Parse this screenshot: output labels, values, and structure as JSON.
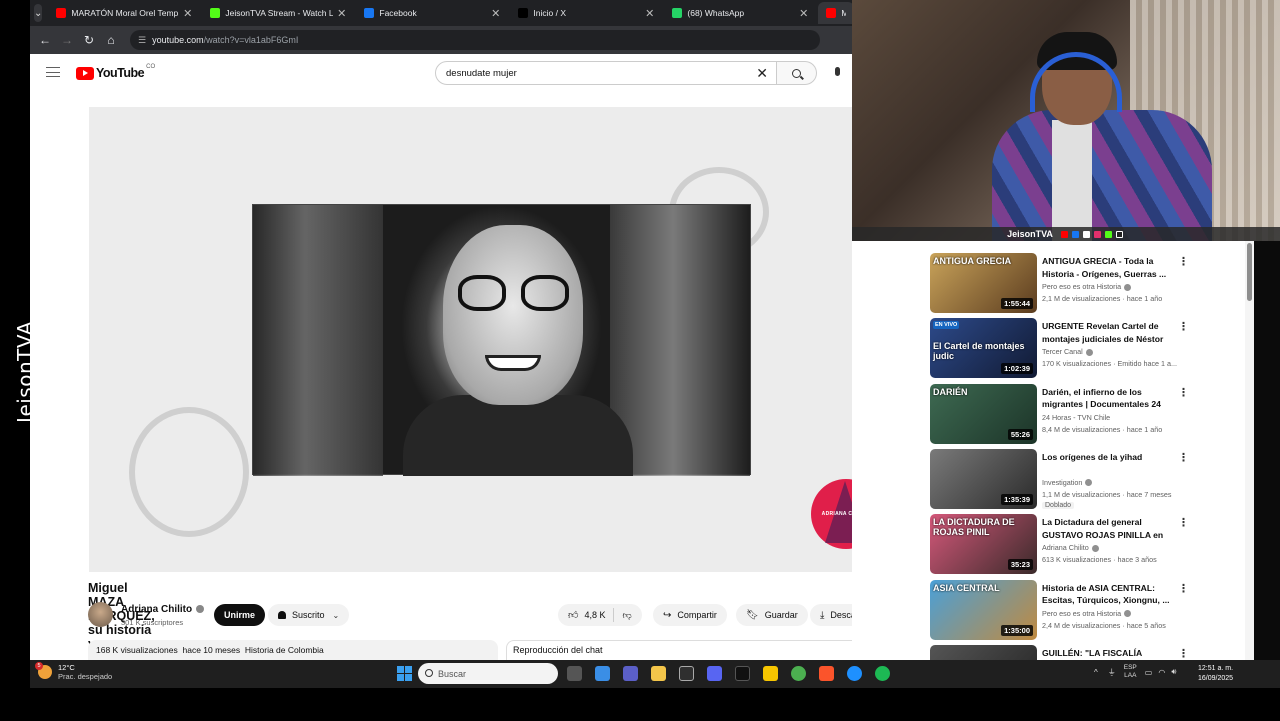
{
  "stream_brand": "JeisonTVA",
  "browser": {
    "tabs": [
      {
        "title": "MARATÓN Moral Orel Temp. 2",
        "favicon_color": "#ff0000",
        "active": false
      },
      {
        "title": "JeisonTVA Stream - Watch Live",
        "favicon_color": "#53fc18",
        "active": false
      },
      {
        "title": "Facebook",
        "favicon_color": "#1877f2",
        "active": false
      },
      {
        "title": "Inicio / X",
        "favicon_color": "#000000",
        "active": false
      },
      {
        "title": "(68) WhatsApp",
        "favicon_color": "#25d366",
        "active": false
      },
      {
        "title": "Migu",
        "favicon_color": "#ff0000",
        "active": true
      }
    ],
    "url_domain": "youtube.com",
    "url_path": "/watch?v=vla1abF6GmI"
  },
  "youtube": {
    "logo_text": "YouTube",
    "country_code": "CO",
    "search_value": "desnudate mujer",
    "video": {
      "title": "Miguel MAZA MÁRQUEZ, su historia y trayectoria como director del DAS/ Documental",
      "watermark": "ADRIANA CHILITO",
      "channel": "Adriana Chilito",
      "subscribers": "301 K suscriptores",
      "join_label": "Unirme",
      "subscribed_label": "Suscrito",
      "likes": "4,8 K",
      "share_label": "Compartir",
      "save_label": "Guardar",
      "download_label": "Descargar",
      "views": "168 K visualizaciones",
      "age": "hace 10 meses",
      "hashtag": "Historia de Colombia",
      "chat_replay": "Reproducción del chat"
    }
  },
  "webcam_bar": {
    "name": "JeisonTVA"
  },
  "recommendations": [
    {
      "title": "ANTIGUA GRECIA - Toda la Historia - Orígenes, Guerras ...",
      "channel": "Pero eso es otra Historia",
      "verified": true,
      "meta": "2,1 M de visualizaciones · hace 1 año",
      "duration": "1:55:44",
      "overlay": "ANTIGUA GRECIA",
      "thumb": [
        "#c9a35a",
        "#5b3c1f"
      ],
      "badge": ""
    },
    {
      "title": "URGENTE Revelan Cartel de montajes judiciales de Néstor ...",
      "channel": "Tercer Canal",
      "verified": true,
      "meta": "170 K visualizaciones · Emitido hace 1 a...",
      "duration": "1:02:39",
      "overlay": "El Cartel de montajes judic",
      "thumb": [
        "#2d4a8a",
        "#111a33"
      ],
      "badge": "",
      "live": "EN VIVO"
    },
    {
      "title": "Darién, el infierno de los migrantes | Documentales 24",
      "channel": "24 Horas - TVN Chile",
      "verified": false,
      "meta": "8,4 M de visualizaciones · hace 1 año",
      "duration": "55:26",
      "overlay": "DARIÉN",
      "thumb": [
        "#3e6a52",
        "#1c3428"
      ],
      "badge": ""
    },
    {
      "title": "Los orígenes de la yihad",
      "channel": "Investigation",
      "verified": true,
      "meta": "1,1 M de visualizaciones · hace 7 meses",
      "duration": "1:35:39",
      "overlay": "",
      "thumb": [
        "#7a7a7a",
        "#2a2a2a"
      ],
      "badge": "Doblado"
    },
    {
      "title": "La Dictadura del general GUSTAVO ROJAS PINILLA en ...",
      "channel": "Adriana Chilito",
      "verified": true,
      "meta": "613 K visualizaciones · hace 3 años",
      "duration": "35:23",
      "overlay": "LA DICTADURA DE ROJAS PINIL",
      "thumb": [
        "#d4587a",
        "#3a2a2a"
      ],
      "badge": ""
    },
    {
      "title": "Historia de ASIA CENTRAL: Escitas, Túrquicos, Xiongnu, ...",
      "channel": "Pero eso es otra Historia",
      "verified": true,
      "meta": "2,4 M de visualizaciones · hace 5 años",
      "duration": "1:35:00",
      "overlay": "ASIA CENTRAL",
      "thumb": [
        "#4aa0d8",
        "#c08a40"
      ],
      "badge": ""
    },
    {
      "title": "GUILLÉN: \"LA FISCALÍA",
      "channel": "",
      "verified": false,
      "meta": "",
      "duration": "",
      "overlay": "",
      "thumb": [
        "#555555",
        "#222222"
      ],
      "badge": ""
    }
  ],
  "taskbar": {
    "temperature": "12°C",
    "weather_desc": "Prac. despejado",
    "weather_badge": "5",
    "search_placeholder": "Buscar",
    "lang_line1": "ESP",
    "lang_line2": "LAA",
    "time": "12:51 a. m.",
    "date": "16/09/2025"
  }
}
